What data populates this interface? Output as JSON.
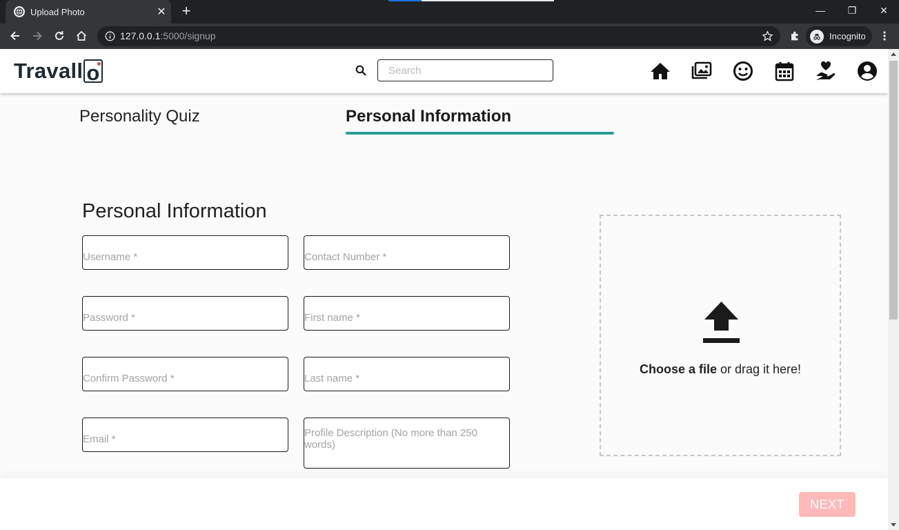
{
  "browser": {
    "tab_title": "Upload Photo",
    "url_host": "127.0.0.1",
    "url_rest": ":5000/signup",
    "profile_label": "Incognito"
  },
  "header": {
    "logo_prefix": "Travall",
    "logo_suffix": "o",
    "search_placeholder": "Search",
    "icons": [
      "home-icon",
      "photos-icon",
      "smiley-icon",
      "calendar-icon",
      "charity-icon",
      "account-icon"
    ]
  },
  "steps": {
    "quiz": "Personality Quiz",
    "info": "Personal Information",
    "active_color": "#2a9d96"
  },
  "form": {
    "title": "Personal Information",
    "username_placeholder": "Username *",
    "contact_placeholder": "Contact Number *",
    "password_placeholder": "Password *",
    "first_name_placeholder": "First name *",
    "confirm_password_placeholder": "Confirm Password *",
    "last_name_placeholder": "Last name *",
    "email_placeholder": "Email *",
    "description_placeholder": "Profile Description (No more than 250 words)"
  },
  "upload": {
    "choose_label": "Choose a file",
    "drag_label": " or drag it here!"
  },
  "footer": {
    "next_label": "NEXT",
    "next_color": "#ffb9b9"
  }
}
